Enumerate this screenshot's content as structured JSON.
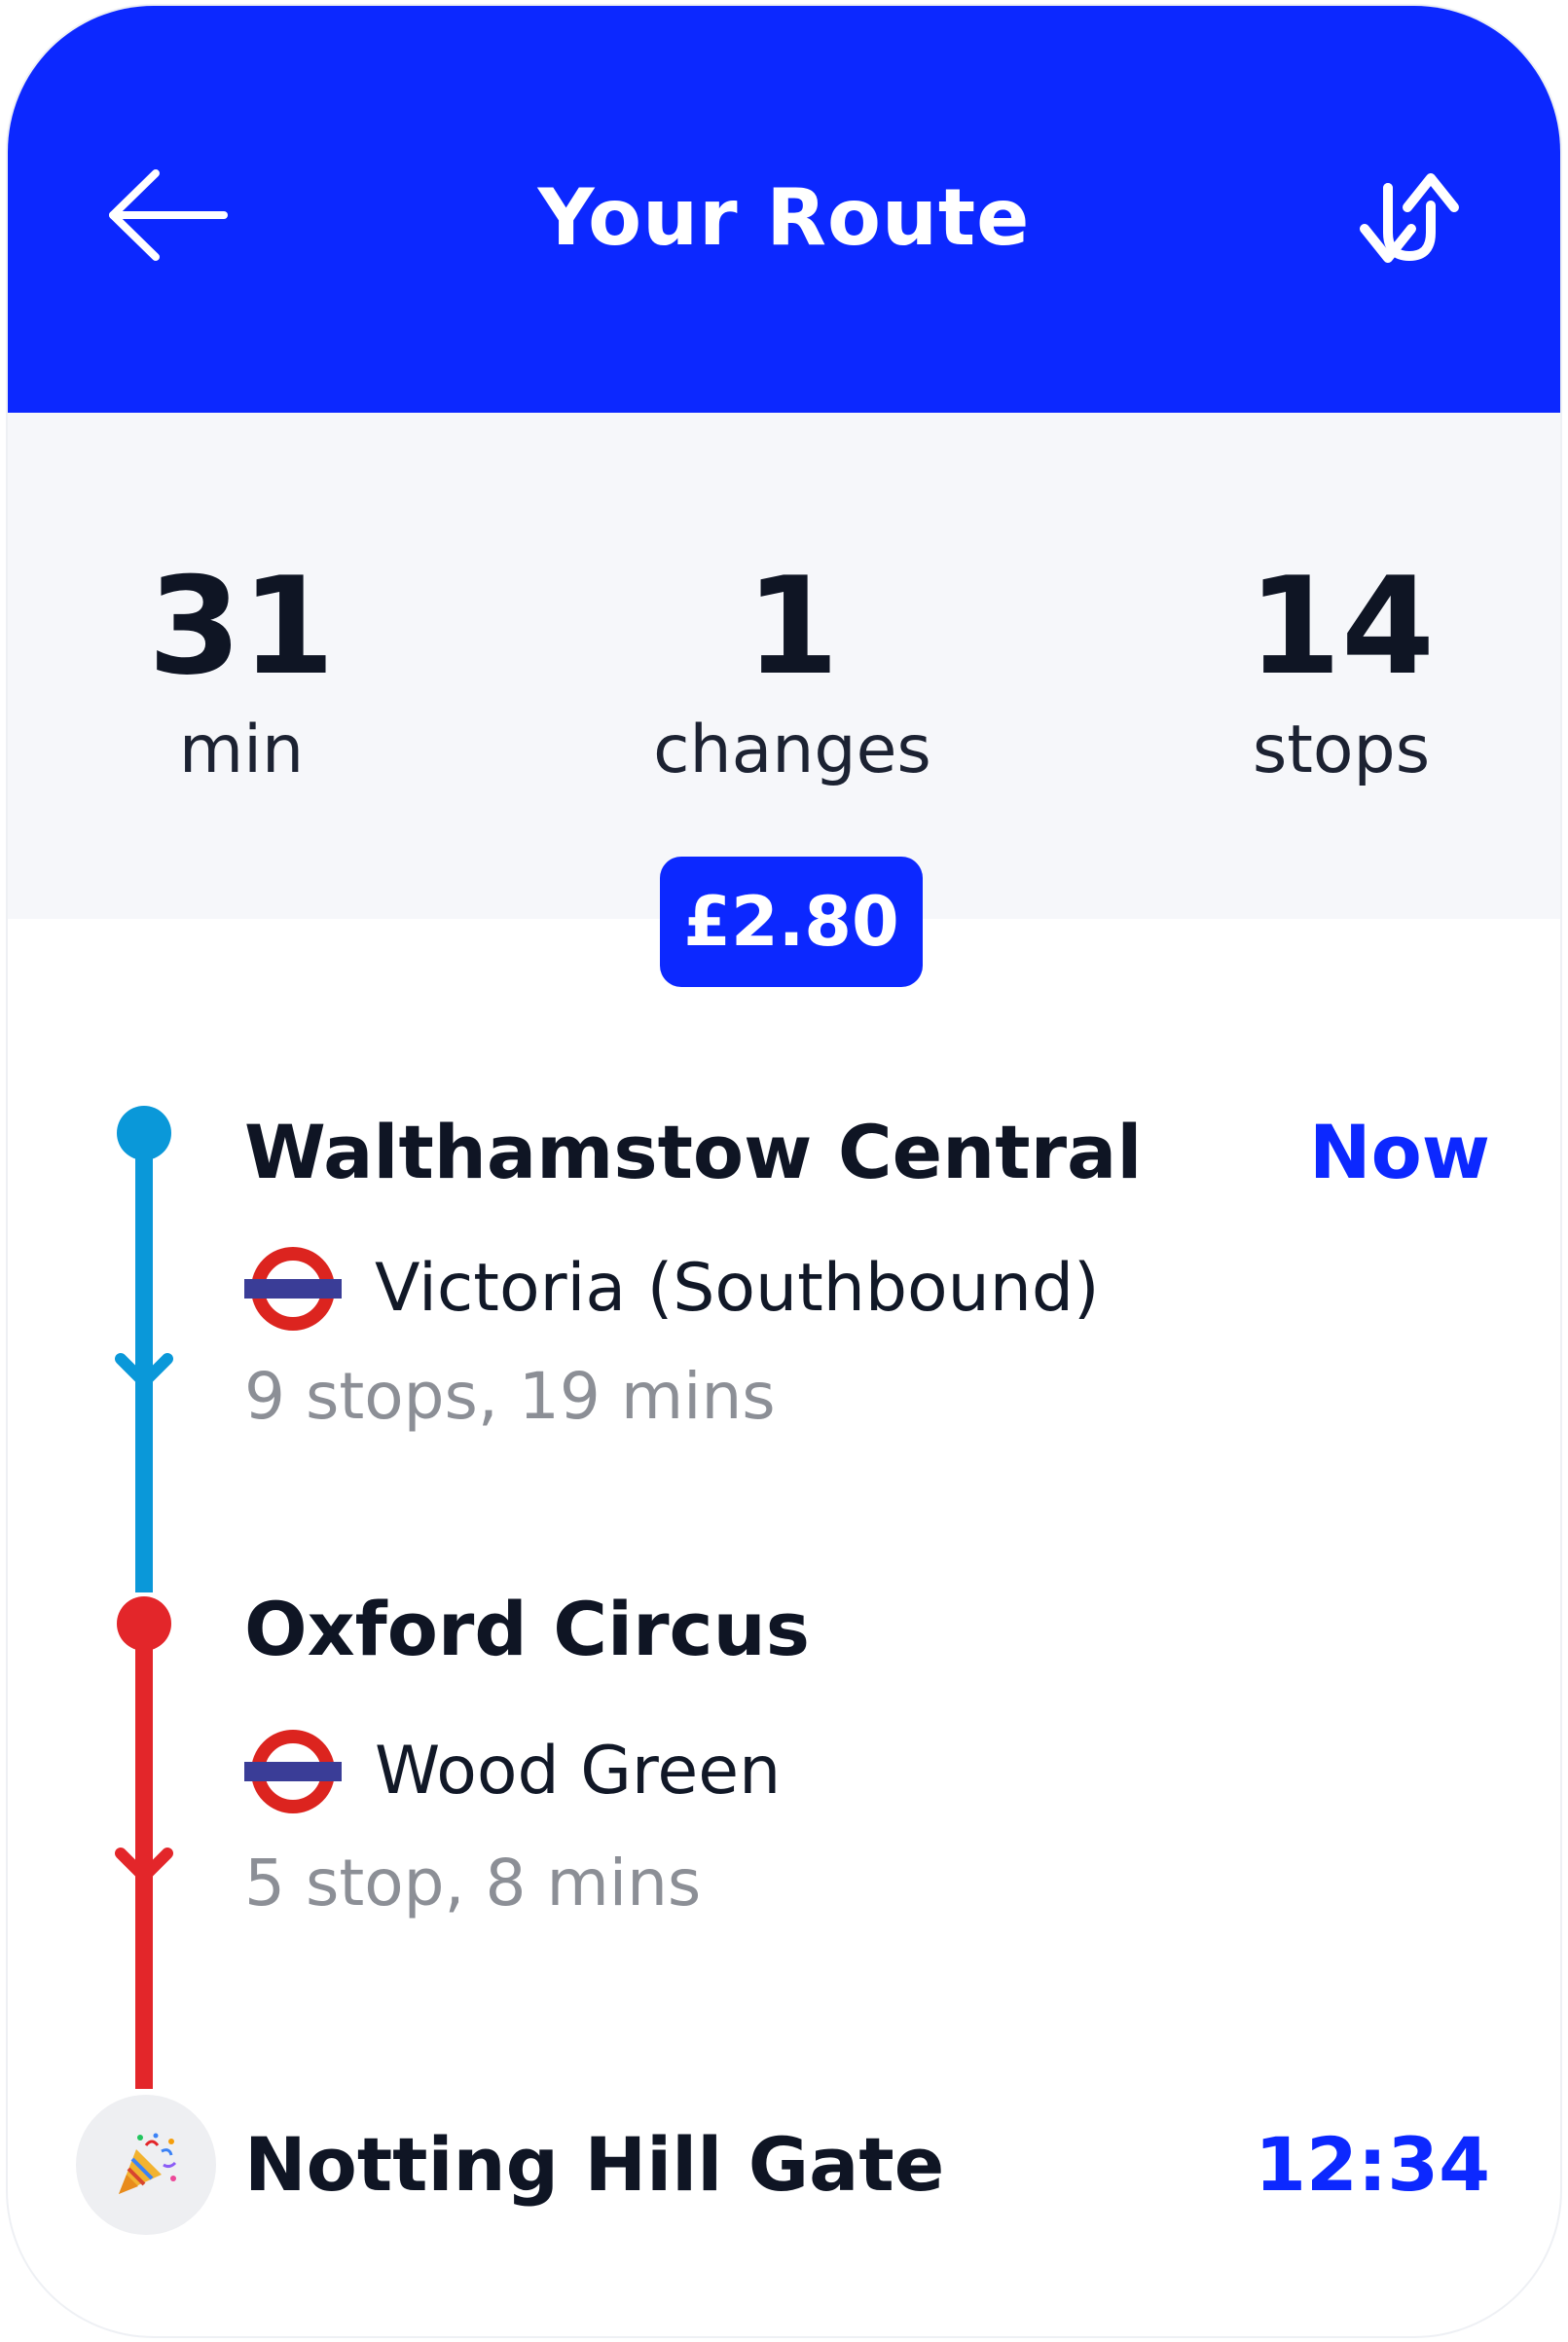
{
  "header": {
    "title": "Your Route",
    "back_icon": "arrow-left-icon",
    "swap_icon": "swap-direction-icon",
    "background_color": "#0c28ff"
  },
  "summary": {
    "duration_value": "31",
    "duration_label": "min",
    "changes_value": "1",
    "changes_label": "changes",
    "stops_value": "14",
    "stops_label": "stops",
    "fare": "£2.80"
  },
  "route": {
    "legs": [
      {
        "station": "Walthamstow Central",
        "time": "Now",
        "line_icon": "london-underground-roundel-icon",
        "line": "Victoria (Southbound)",
        "meta": "9 stops, 19 mins",
        "color": "#0a98d9"
      },
      {
        "station": "Oxford Circus",
        "line_icon": "london-underground-roundel-icon",
        "line": "Wood Green",
        "meta": "5 stop, 8 mins",
        "color": "#e3262a"
      }
    ],
    "destination": {
      "station": "Notting Hill Gate",
      "time": "12:34",
      "icon": "party-popper-icon"
    }
  },
  "colors": {
    "accent": "#0c28ff",
    "victoria_line": "#0a98d9",
    "central_line": "#e3262a",
    "roundel_red": "#dc241f",
    "roundel_bar": "#3a3d97",
    "meta_text": "#8c8f96"
  }
}
